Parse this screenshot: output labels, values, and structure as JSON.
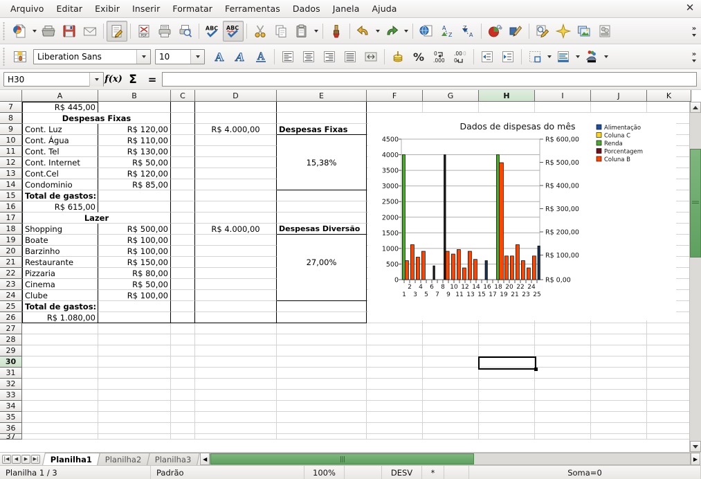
{
  "window": {
    "close_label": "✕"
  },
  "menubar": {
    "items": [
      {
        "label": "Arquivo"
      },
      {
        "label": "Editar"
      },
      {
        "label": "Exibir"
      },
      {
        "label": "Inserir"
      },
      {
        "label": "Formatar"
      },
      {
        "label": "Ferramentas"
      },
      {
        "label": "Dados"
      },
      {
        "label": "Janela"
      },
      {
        "label": "Ajuda"
      }
    ]
  },
  "toolbar_standard": {
    "icons": [
      "new-document-icon",
      "new-document-dropdown",
      "open-icon",
      "save-icon",
      "email-icon",
      "edit-mode-icon",
      "export-pdf-icon",
      "print-icon",
      "print-preview-icon",
      "spelling-icon",
      "autospellcheck-icon",
      "cut-icon",
      "copy-icon",
      "paste-icon",
      "paste-dropdown",
      "clone-formatting-icon",
      "undo-icon",
      "undo-dropdown",
      "redo-icon",
      "redo-dropdown",
      "hyperlink-icon",
      "sort-ascending-icon",
      "sort-descending-icon",
      "chart-icon",
      "draw-functions-icon",
      "find-replace-icon",
      "special-character-icon",
      "insert-image-icon",
      "gallery-icon"
    ],
    "overflow_label": "»"
  },
  "toolbar_format": {
    "font_name": "Liberation Sans",
    "font_size": "10",
    "icons": [
      "styles-icon",
      "bold-icon",
      "italic-icon",
      "underline-icon",
      "align-left-icon",
      "align-center-icon",
      "align-right-icon",
      "align-justified-icon",
      "merge-cells-icon",
      "currency-format-icon",
      "percent-format-icon",
      "add-decimal-icon",
      "delete-decimal-icon",
      "decrease-indent-icon",
      "increase-indent-icon",
      "borders-icon",
      "borders-dropdown",
      "border-style-icon",
      "border-style-dropdown",
      "background-color-icon",
      "background-color-dropdown"
    ],
    "overflow_label": "»"
  },
  "formula_bar": {
    "name_box_value": "H30",
    "function_wizard_label": "f(x)",
    "sum_label": "Σ",
    "equals_label": "=",
    "input_value": ""
  },
  "grid": {
    "column_headers": [
      "A",
      "B",
      "C",
      "D",
      "E",
      "F",
      "G",
      "H",
      "I",
      "J",
      "K"
    ],
    "selected_column": "H",
    "selected_row": "30",
    "row_headers": [
      "7",
      "8",
      "9",
      "10",
      "11",
      "12",
      "13",
      "14",
      "15",
      "16",
      "17",
      "18",
      "19",
      "20",
      "21",
      "22",
      "23",
      "24",
      "25",
      "26",
      "27",
      "28",
      "29",
      "30",
      "31",
      "32",
      "33",
      "34",
      "35",
      "36",
      "37"
    ],
    "cells": {
      "7": {
        "A": "R$ 445,00"
      },
      "8": {
        "merged_AB": "Despesas Fixas"
      },
      "9": {
        "A": "Cont. Luz",
        "B": "R$ 120,00",
        "D": "R$ 4.000,00",
        "E": "Despesas Fixas"
      },
      "10": {
        "A": "Cont. Água",
        "B": "R$ 110,00"
      },
      "11": {
        "A": "Cont. Tel",
        "B": "R$ 130,00"
      },
      "12": {
        "A": "Cont. Internet",
        "B": "R$ 50,00",
        "E_merged": "15,38%"
      },
      "13": {
        "A": "Cont.Cel",
        "B": "R$ 120,00"
      },
      "14": {
        "A": "Condominio",
        "B": "R$ 85,00"
      },
      "15": {
        "A": "Total de gastos:"
      },
      "16": {
        "A": "R$ 615,00"
      },
      "17": {
        "merged_AB": "Lazer"
      },
      "18": {
        "A": "Shopping",
        "B": "R$ 500,00",
        "D": "R$ 4.000,00",
        "E": "Despesas Diversão"
      },
      "19": {
        "A": "Boate",
        "B": "R$ 100,00"
      },
      "20": {
        "A": "Barzinho",
        "B": "R$ 100,00"
      },
      "21": {
        "A": "Restaurante",
        "B": "R$ 150,00",
        "E_merged": "27,00%"
      },
      "22": {
        "A": "Pizzaria",
        "B": "R$ 80,00"
      },
      "23": {
        "A": "Cinema",
        "B": "R$ 50,00"
      },
      "24": {
        "A": "Clube",
        "B": "R$ 100,00"
      },
      "25": {
        "A": "Total de gastos:"
      },
      "26": {
        "A": "R$ 1.080,00"
      }
    }
  },
  "chart_data": {
    "type": "bar",
    "title": "Dados de dispesas do mês",
    "xlabel": "",
    "ylabel": "",
    "ylim": [
      0,
      4500
    ],
    "y2lim": [
      0,
      600
    ],
    "yticks": [
      "0",
      "500",
      "1000",
      "1500",
      "2000",
      "2500",
      "3000",
      "3500",
      "4000",
      "4500"
    ],
    "y2ticks": [
      "R$ 0,00",
      "R$ 100,00",
      "R$ 200,00",
      "R$ 300,00",
      "R$ 400,00",
      "R$ 500,00",
      "R$ 600,00"
    ],
    "categories": [
      "1",
      "2",
      "3",
      "4",
      "5",
      "6",
      "7",
      "8",
      "9",
      "10",
      "11",
      "12",
      "13",
      "14",
      "15",
      "16",
      "17",
      "18",
      "19",
      "20",
      "21",
      "22",
      "23",
      "24",
      "25"
    ],
    "grid": true,
    "legend_position": "right",
    "legend": [
      {
        "name": "Alimentação",
        "color": "#1f4e9c"
      },
      {
        "name": "Coluna C",
        "color": "#ffd320"
      },
      {
        "name": "Renda",
        "color": "#4ea72e"
      },
      {
        "name": "Porcentagem",
        "color": "#6b0f1a"
      },
      {
        "name": "Coluna B",
        "color": "#ff4500"
      }
    ],
    "series": [
      {
        "name": "Coluna B",
        "color": "#ff4500",
        "values": [
          610,
          1120,
          720,
          910,
          0,
          0,
          0,
          910,
          830,
          970,
          375,
          910,
          650,
          0,
          0,
          0,
          3740,
          760,
          760,
          1120,
          610,
          375,
          760,
          0,
          0
        ]
      },
      {
        "name": "Renda",
        "color": "#4ea72e",
        "values": [
          4000,
          0,
          0,
          0,
          0,
          0,
          0,
          0,
          0,
          0,
          0,
          0,
          0,
          0,
          0,
          0,
          4000,
          0,
          0,
          0,
          0,
          0,
          0,
          0,
          0
        ]
      },
      {
        "name": "Alimentação",
        "color": "#1f4e9c",
        "values": [
          0,
          0,
          0,
          0,
          0,
          0,
          0,
          0,
          0,
          0,
          0,
          0,
          0,
          0,
          610,
          0,
          0,
          0,
          0,
          0,
          0,
          0,
          0,
          0,
          1080
        ]
      },
      {
        "name": "Porcentagem",
        "color": "#1a1a1a",
        "values": [
          0,
          0,
          0,
          0,
          0,
          440,
          0,
          4000,
          0,
          0,
          0,
          0,
          0,
          0,
          0,
          0,
          0,
          0,
          0,
          0,
          0,
          0,
          0,
          0,
          0
        ]
      }
    ]
  },
  "sheet_tabs": {
    "nav": [
      "first-sheet",
      "prev-sheet",
      "next-sheet",
      "last-sheet"
    ],
    "tabs": [
      {
        "label": "Planilha1",
        "active": true
      },
      {
        "label": "Planilha2",
        "active": false
      },
      {
        "label": "Planilha3",
        "active": false
      }
    ]
  },
  "status_bar": {
    "sheet_info": "Planilha 1 / 3",
    "page_style": "Padrão",
    "zoom": "100%",
    "insert_mode": "",
    "selection_mode": "DESV",
    "modified": "*",
    "signature": "",
    "sum": "Soma=0"
  }
}
